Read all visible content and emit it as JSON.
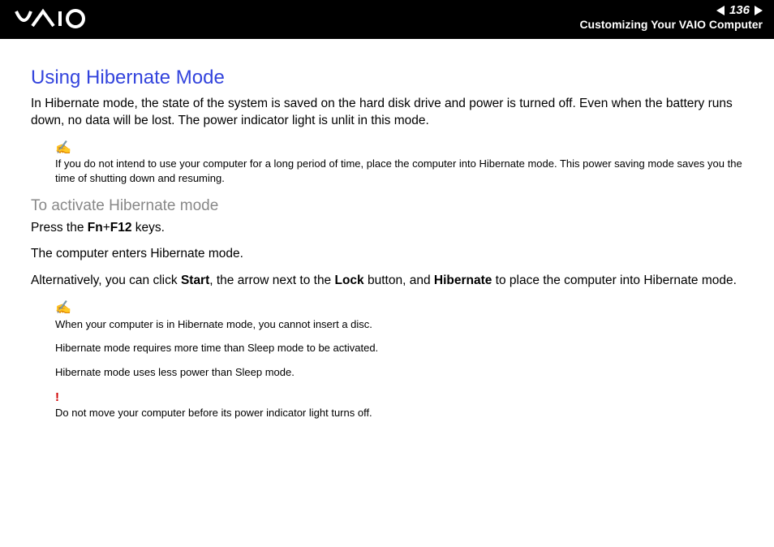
{
  "header": {
    "page_number": "136",
    "breadcrumb": "Customizing Your VAIO Computer"
  },
  "content": {
    "title": "Using Hibernate Mode",
    "intro": "In Hibernate mode, the state of the system is saved on the hard disk drive and power is turned off. Even when the battery runs down, no data will be lost. The power indicator light is unlit in this mode.",
    "note1": "If you do not intend to use your computer for a long period of time, place the computer into Hibernate mode. This power saving mode saves you the time of shutting down and resuming.",
    "subheading": "To activate Hibernate mode",
    "press_pre": "Press the ",
    "press_keys": "Fn",
    "press_plus": "+",
    "press_keys2": "F12",
    "press_post": " keys.",
    "enters": "The computer enters Hibernate mode.",
    "alt_pre": "Alternatively, you can click ",
    "alt_b1": "Start",
    "alt_mid1": ", the arrow next to the ",
    "alt_b2": "Lock",
    "alt_mid2": " button, and ",
    "alt_b3": "Hibernate",
    "alt_post": " to place the computer into Hibernate mode.",
    "note2a": "When your computer is in Hibernate mode, you cannot insert a disc.",
    "note2b": "Hibernate mode requires more time than Sleep mode to be activated.",
    "note2c": "Hibernate mode uses less power than Sleep mode.",
    "warning": "Do not move your computer before its power indicator light turns off."
  }
}
